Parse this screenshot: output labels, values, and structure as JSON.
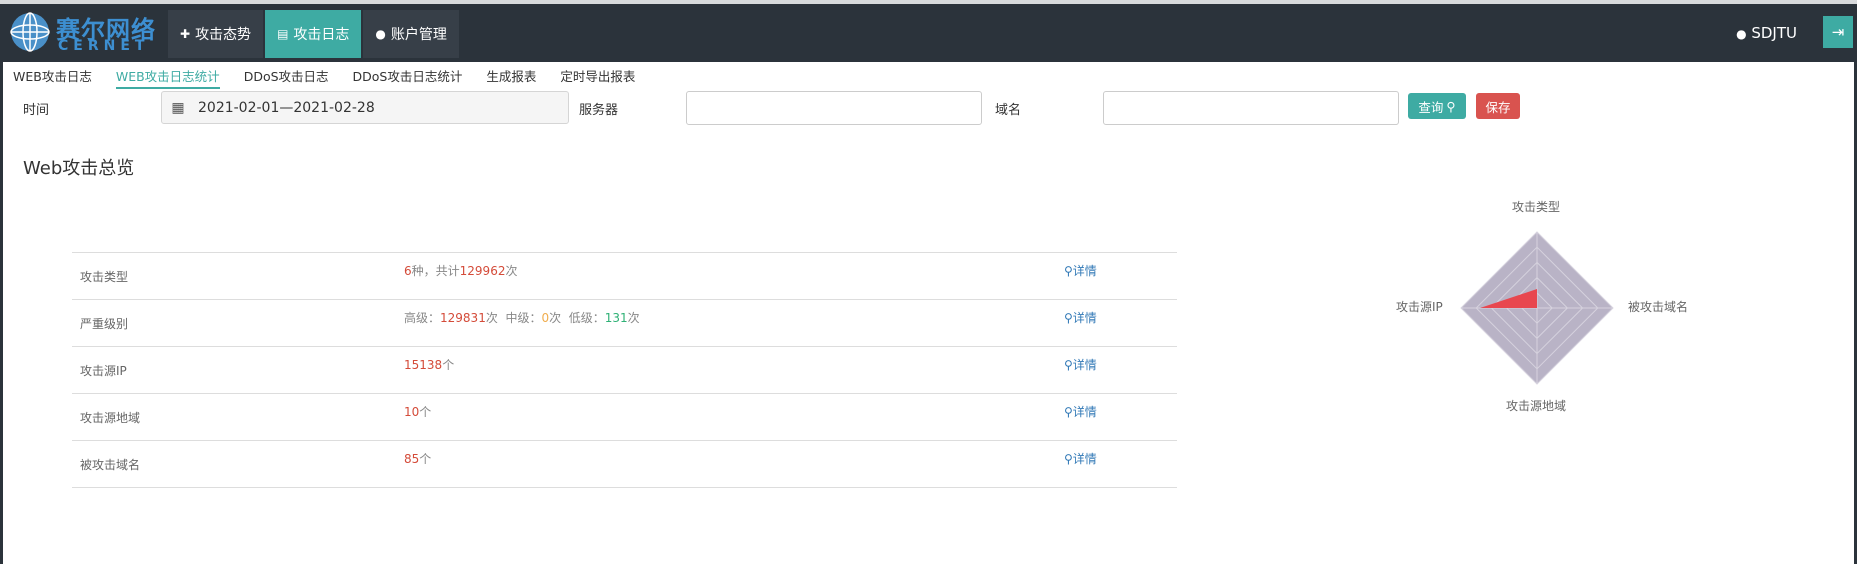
{
  "brand": {
    "name_cn": "赛尔网络",
    "name_en": "CERNET"
  },
  "nav": [
    {
      "icon": "plus-icon",
      "label": "攻击态势",
      "active": false
    },
    {
      "icon": "book-icon",
      "label": "攻击日志",
      "active": true
    },
    {
      "icon": "user-icon",
      "label": "账户管理",
      "active": false
    }
  ],
  "user": {
    "name": "SDJTU"
  },
  "subtabs": [
    {
      "label": "WEB攻击日志",
      "active": false
    },
    {
      "label": "WEB攻击日志统计",
      "active": true
    },
    {
      "label": "DDoS攻击日志",
      "active": false
    },
    {
      "label": "DDoS攻击日志统计",
      "active": false
    },
    {
      "label": "生成报表",
      "active": false
    },
    {
      "label": "定时导出报表",
      "active": false
    }
  ],
  "filters": {
    "time_label": "时间",
    "date_range": "2021-02-01—2021-02-28",
    "server_label": "服务器",
    "server_value": "",
    "domain_label": "域名",
    "domain_value": "",
    "query_button": "查询",
    "save_button": "保存"
  },
  "overview": {
    "title": "Web攻击总览",
    "detail_label": "详情",
    "rows": [
      {
        "label": "攻击类型",
        "parts": [
          {
            "t": "6",
            "c": "red"
          },
          {
            "t": "种，共计",
            "c": ""
          },
          {
            "t": "129962",
            "c": "red"
          },
          {
            "t": "次",
            "c": ""
          }
        ]
      },
      {
        "label": "严重级别",
        "parts": [
          {
            "t": "高级：",
            "c": ""
          },
          {
            "t": "129831",
            "c": "red"
          },
          {
            "t": "次  中级：",
            "c": ""
          },
          {
            "t": "0",
            "c": "orange"
          },
          {
            "t": "次  低级：",
            "c": ""
          },
          {
            "t": "131",
            "c": "green"
          },
          {
            "t": "次",
            "c": ""
          }
        ]
      },
      {
        "label": "攻击源IP",
        "parts": [
          {
            "t": "15138",
            "c": "red"
          },
          {
            "t": "个",
            "c": ""
          }
        ]
      },
      {
        "label": "攻击源地域",
        "parts": [
          {
            "t": "10",
            "c": "red"
          },
          {
            "t": "个",
            "c": ""
          }
        ]
      },
      {
        "label": "被攻击域名",
        "parts": [
          {
            "t": "85",
            "c": "red"
          },
          {
            "t": "个",
            "c": ""
          }
        ]
      }
    ]
  },
  "radar": {
    "axes": [
      "攻击类型",
      "被攻击域名",
      "攻击源地域",
      "攻击源IP"
    ],
    "values_fraction": [
      0.25,
      0.0,
      0.0,
      0.75
    ],
    "fill_color": "#e8474f",
    "background_color": "#b9b3c6"
  }
}
